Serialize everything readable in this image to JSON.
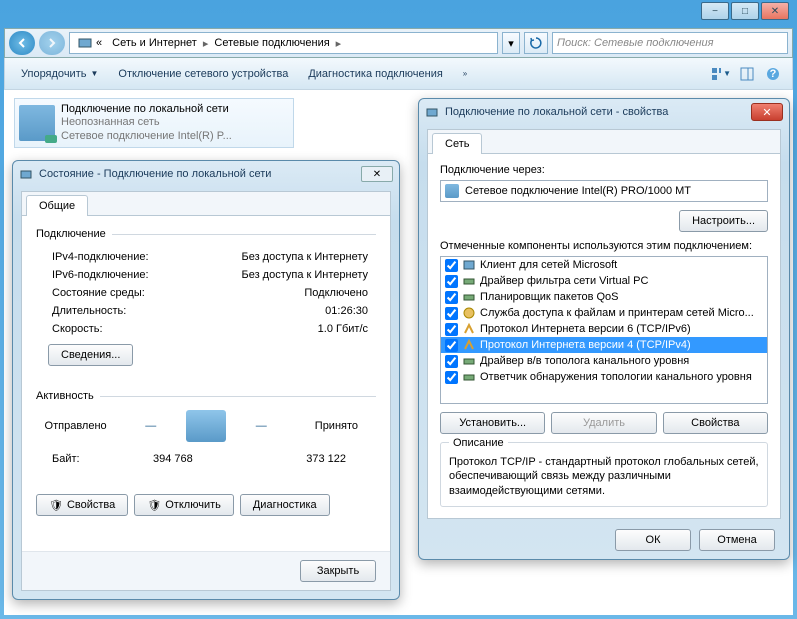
{
  "window_controls": {
    "minimize": "−",
    "maximize": "□",
    "close": "✕"
  },
  "breadcrumb": {
    "root": "«",
    "part1": "Сеть и Интернет",
    "part2": "Сетевые подключения"
  },
  "search": {
    "placeholder": "Поиск: Сетевые подключения"
  },
  "command_bar": {
    "organize": "Упорядочить",
    "disable": "Отключение сетевого устройства",
    "diagnose": "Диагностика подключения"
  },
  "connection_item": {
    "title": "Подключение по локальной сети",
    "sub1": "Неопознанная сеть",
    "sub2": "Сетевое подключение Intel(R) P..."
  },
  "status_dialog": {
    "title": "Состояние - Подключение по локальной сети",
    "tab": "Общие",
    "section_connection": "Подключение",
    "rows": {
      "ipv4_label": "IPv4-подключение:",
      "ipv4_value": "Без доступа к Интернету",
      "ipv6_label": "IPv6-подключение:",
      "ipv6_value": "Без доступа к Интернету",
      "media_label": "Состояние среды:",
      "media_value": "Подключено",
      "duration_label": "Длительность:",
      "duration_value": "01:26:30",
      "speed_label": "Скорость:",
      "speed_value": "1.0 Гбит/с"
    },
    "details_btn": "Сведения...",
    "section_activity": "Активность",
    "sent_label": "Отправлено",
    "recv_label": "Принято",
    "bytes_label": "Байт:",
    "sent_bytes": "394 768",
    "recv_bytes": "373 122",
    "props_btn": "Свойства",
    "disable_btn": "Отключить",
    "diag_btn": "Диагностика",
    "close_btn": "Закрыть"
  },
  "props_dialog": {
    "title": "Подключение по локальной сети - свойства",
    "tab": "Сеть",
    "connect_via": "Подключение через:",
    "adapter": "Сетевое подключение Intel(R) PRO/1000 MT",
    "configure_btn": "Настроить...",
    "components_label": "Отмеченные компоненты используются этим подключением:",
    "components": [
      {
        "checked": true,
        "icon": "client",
        "label": "Клиент для сетей Microsoft"
      },
      {
        "checked": true,
        "icon": "driver",
        "label": "Драйвер фильтра сети Virtual PC"
      },
      {
        "checked": true,
        "icon": "driver",
        "label": "Планировщик пакетов QoS"
      },
      {
        "checked": true,
        "icon": "service",
        "label": "Служба доступа к файлам и принтерам сетей Micro..."
      },
      {
        "checked": true,
        "icon": "proto",
        "label": "Протокол Интернета версии 6 (TCP/IPv6)"
      },
      {
        "checked": true,
        "icon": "proto",
        "label": "Протокол Интернета версии 4 (TCP/IPv4)",
        "selected": true
      },
      {
        "checked": true,
        "icon": "driver",
        "label": "Драйвер в/в тополога канального уровня"
      },
      {
        "checked": true,
        "icon": "driver",
        "label": "Ответчик обнаружения топологии канального уровня"
      }
    ],
    "install_btn": "Установить...",
    "remove_btn": "Удалить",
    "props_btn": "Свойства",
    "desc_legend": "Описание",
    "desc_text": "Протокол TCP/IP - стандартный протокол глобальных сетей, обеспечивающий связь между различными взаимодействующими сетями.",
    "ok": "ОК",
    "cancel": "Отмена"
  }
}
